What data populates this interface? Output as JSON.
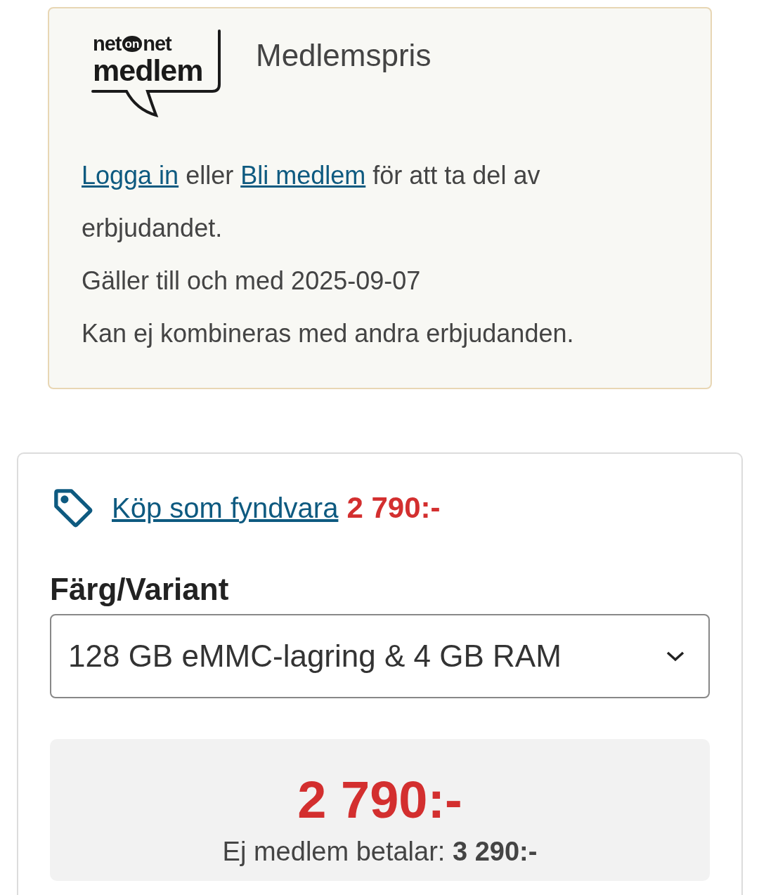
{
  "member_card": {
    "logo": {
      "brand_left": "net",
      "brand_mid": "on",
      "brand_right": "net",
      "word": "medlem"
    },
    "title": "Medlemspris",
    "offer": [
      {
        "kind": "link",
        "text": "Logga in"
      },
      {
        "kind": "text",
        "text": "eller"
      },
      {
        "kind": "link",
        "text": "Bli medlem"
      },
      {
        "kind": "text",
        "text": "för att ta del av erbjudandet."
      }
    ],
    "validity": "Gäller till och med 2025-09-07",
    "note": "Kan ej kombineras med andra erbjudanden."
  },
  "purchase_card": {
    "outlet_link": "Köp som fyndvara",
    "outlet_price": "2 790:-",
    "variant_label": "Färg/Variant",
    "variant_value": "128 GB eMMC-lagring & 4 GB RAM",
    "price": "2 790:-",
    "non_member": "Ej medlem betalar: **3 290:-**"
  }
}
